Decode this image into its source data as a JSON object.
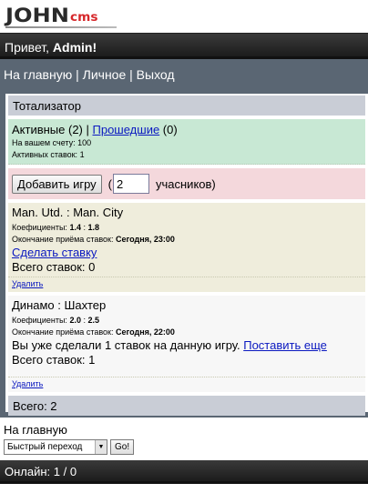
{
  "logo": {
    "main": "JOHN",
    "sub": "cms"
  },
  "greeting": {
    "prefix": "Привет, ",
    "user": "Admin",
    "suffix": "!"
  },
  "topnav": {
    "home": "На главную",
    "sep1": " | ",
    "personal": "Личное",
    "sep2": " | ",
    "logout": "Выход"
  },
  "header": {
    "title": "Тотализатор"
  },
  "active": {
    "label": "Активные",
    "count": " (2) | ",
    "past_label": "Прошедшие",
    "past_count": " (0)",
    "balance_label": "На вашем счету: ",
    "balance_value": "100",
    "stakes_label": "Активных ставок: ",
    "stakes_value": "1"
  },
  "add_game": {
    "button": "Добавить игру",
    "open_paren": "(",
    "participants_value": "2",
    "participants_label": "учасников)"
  },
  "games": [
    {
      "title": "Man. Utd. : Man. City",
      "coef_label": "Коефициенты: ",
      "coef1": "1.4",
      "coef_sep": " : ",
      "coef2": "1.8",
      "deadline_label": "Окончание приёма ставок: ",
      "deadline_value": "Сегодня, 23:00",
      "bet_link": "Сделать ставку",
      "total_bets": "Всего ставок: 0",
      "delete": "Удалить"
    },
    {
      "title": "Динамо : Шахтер",
      "coef_label": "Коефициенты: ",
      "coef1": "2.0",
      "coef_sep": " : ",
      "coef2": "2.5",
      "deadline_label": "Окончание приёма ставок: ",
      "deadline_value": "Сегодня, 22:00",
      "already_text": "Вы уже сделали 1 ставок на данную игру. ",
      "more_link": "Поставить еще",
      "total_bets": "Всего ставок: 1",
      "delete": "Удалить"
    }
  ],
  "total": "Всего: 2",
  "bottom": {
    "home": "На главную",
    "quick_jump": "Быстрый переход",
    "go": "Go!"
  },
  "footer": {
    "online": "Онлайн: 1 / 0"
  },
  "colors": {
    "accent_link": "#0a18c0",
    "logo_red": "#d6272a",
    "nav_bg": "#5a6673",
    "header_bg": "#c9cdd6",
    "active_bg": "#c8e8d4",
    "add_bg": "#f4d8dc",
    "game1_bg": "#efeddc",
    "game2_bg": "#f7f7f7"
  }
}
